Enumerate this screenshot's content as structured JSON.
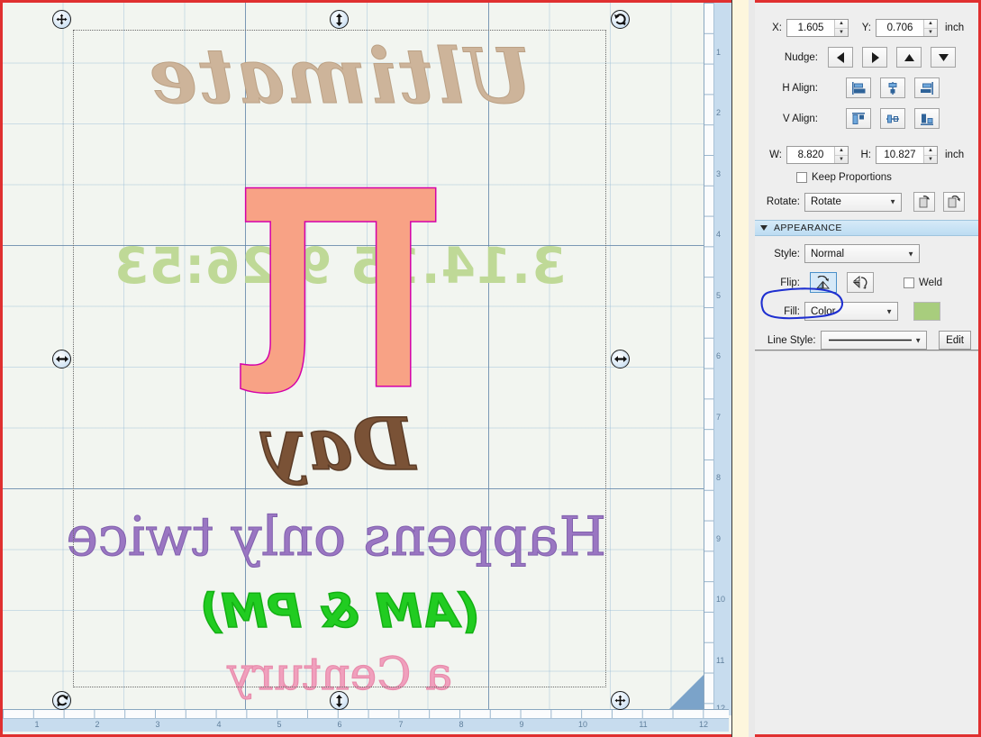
{
  "app": {
    "accent_border": "#e03030",
    "canvas_bg": "#f2f5f0"
  },
  "transform_panel": {
    "x_label": "X:",
    "x_value": "1.605",
    "y_label": "Y:",
    "y_value": "0.706",
    "xy_unit": "inch",
    "nudge_label": "Nudge:",
    "nudge_buttons": [
      "nudge-left",
      "nudge-right",
      "nudge-up",
      "nudge-down"
    ],
    "h_align_label": "H Align:",
    "h_align_buttons": [
      "align-left",
      "align-center",
      "align-right"
    ],
    "v_align_label": "V Align:",
    "v_align_buttons": [
      "align-top",
      "align-middle",
      "align-bottom"
    ],
    "w_label": "W:",
    "w_value": "8.820",
    "h_label": "H:",
    "h_value": "10.827",
    "wh_unit": "inch",
    "keep_proportions_label": "Keep Proportions",
    "keep_proportions_checked": false,
    "rotate_label": "Rotate:",
    "rotate_value": "Rotate"
  },
  "appearance": {
    "section_title": "APPEARANCE",
    "style_label": "Style:",
    "style_value": "Normal",
    "flip_label": "Flip:",
    "flip_horizontal_active": true,
    "flip_vertical_active": false,
    "weld_label": "Weld",
    "weld_checked": false,
    "fill_label": "Fill:",
    "fill_value": "Color",
    "fill_color": "#a8cd7d",
    "line_style_label": "Line Style:",
    "line_style_edit": "Edit",
    "annotation": "blue-ellipse-around-flip"
  },
  "canvas": {
    "ruler_unit": "inch",
    "ruler_bottom_ticks": [
      "1",
      "2",
      "3",
      "4",
      "5",
      "6",
      "7",
      "8",
      "9",
      "10",
      "11",
      "12"
    ],
    "ruler_right_ticks": [
      "1",
      "2",
      "3",
      "4",
      "5",
      "6",
      "7",
      "8",
      "9",
      "10",
      "11",
      "12"
    ],
    "selection_handles": [
      "move-handle",
      "resize-vertical-handle",
      "rotate-handle",
      "resize-horizontal-handle",
      "resize-horizontal-handle",
      "rotate-handle",
      "resize-vertical-handle",
      "resize-all-handle"
    ]
  },
  "artwork": {
    "mirrored": true,
    "lines": [
      {
        "text": "Ultimate",
        "color": "#cdb49a"
      },
      {
        "text": "3.14.15 9:26:53",
        "color": "#bfd997"
      },
      {
        "text": "π",
        "color": "#f8a285",
        "outline": "#d400a8"
      },
      {
        "text": "Day",
        "color": "#7a5236"
      },
      {
        "text": "Happens only twice",
        "color": "#9a76c2"
      },
      {
        "text": "(AM & PM)",
        "color": "#21cc21"
      },
      {
        "text": "a Century",
        "color": "#f0a0bd"
      }
    ]
  }
}
